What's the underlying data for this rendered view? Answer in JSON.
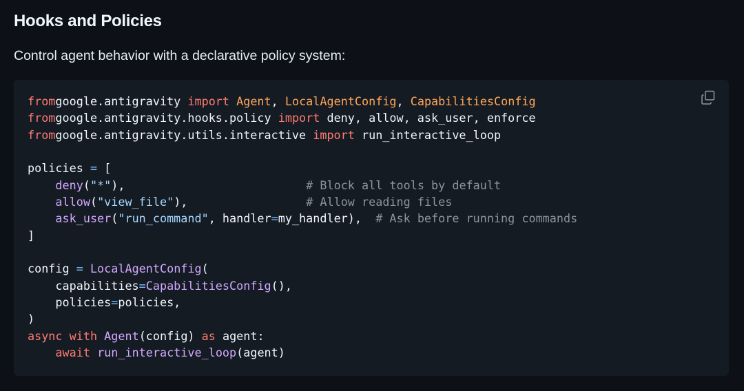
{
  "article": {
    "heading": "Hooks and Policies",
    "intro": "Control agent behavior with a declarative policy system:"
  },
  "code_block": {
    "copy_icon": "copy-icon",
    "language": "python",
    "lines": [
      [
        [
          "kw",
          "from"
        ],
        [
          "",
          "google.antigravity "
        ],
        [
          "kw",
          "import"
        ],
        [
          "",
          ""
        ],
        [
          "cls",
          "Agent"
        ],
        [
          "",
          ", "
        ],
        [
          "cls",
          "LocalAgentConfig"
        ],
        [
          "",
          ", "
        ],
        [
          "cls",
          "CapabilitiesConfig"
        ]
      ],
      [
        [
          "kw",
          "from"
        ],
        [
          "",
          "google.antigravity.hooks.policy "
        ],
        [
          "kw",
          "import"
        ],
        [
          "",
          ""
        ],
        [
          "",
          "deny, allow, ask_user, enforce"
        ]
      ],
      [
        [
          "kw",
          "from"
        ],
        [
          "",
          "google.antigravity.utils.interactive "
        ],
        [
          "kw",
          "import"
        ],
        [
          "",
          ""
        ],
        [
          "",
          "run_interactive_loop"
        ]
      ],
      [],
      [
        [
          "",
          "policies "
        ],
        [
          "op",
          "="
        ],
        [
          "",
          " ["
        ]
      ],
      [
        [
          "",
          "    "
        ],
        [
          "fn",
          "deny"
        ],
        [
          "",
          "("
        ],
        [
          "str",
          "\"*\""
        ],
        [
          "",
          "),"
        ],
        [
          "",
          "                          "
        ],
        [
          "cm",
          "# Block all tools by default"
        ]
      ],
      [
        [
          "",
          "    "
        ],
        [
          "fn",
          "allow"
        ],
        [
          "",
          "("
        ],
        [
          "str",
          "\"view_file\""
        ],
        [
          "",
          "),"
        ],
        [
          "",
          "                 "
        ],
        [
          "cm",
          "# Allow reading files"
        ]
      ],
      [
        [
          "",
          "    "
        ],
        [
          "fn",
          "ask_user"
        ],
        [
          "",
          "("
        ],
        [
          "str",
          "\"run_command\""
        ],
        [
          "",
          ", handler"
        ],
        [
          "op",
          "="
        ],
        [
          "",
          "my_handler),  "
        ],
        [
          "cm",
          "# Ask before running commands"
        ]
      ],
      [
        [
          "",
          "]"
        ]
      ],
      [],
      [
        [
          "",
          "config "
        ],
        [
          "op",
          "="
        ],
        [
          "",
          ""
        ],
        [
          "fn",
          "LocalAgentConfig"
        ],
        [
          "",
          "("
        ]
      ],
      [
        [
          "",
          "    capabilities"
        ],
        [
          "op",
          "="
        ],
        [
          "fn",
          "CapabilitiesConfig"
        ],
        [
          "",
          "(),"
        ]
      ],
      [
        [
          "",
          "    policies"
        ],
        [
          "op",
          "="
        ],
        [
          "",
          "policies,"
        ]
      ],
      [
        [
          "",
          ")"
        ]
      ],
      [
        [
          "kw",
          "async"
        ],
        [
          "",
          ""
        ],
        [
          "kw",
          "with"
        ],
        [
          "",
          ""
        ],
        [
          "fn",
          "Agent"
        ],
        [
          "",
          "(config) "
        ],
        [
          "kw",
          "as"
        ],
        [
          "",
          " agent:"
        ]
      ],
      [
        [
          "",
          "    "
        ],
        [
          "kw",
          "await"
        ],
        [
          "",
          ""
        ],
        [
          "fn",
          "run_interactive_loop"
        ],
        [
          "",
          "(agent)"
        ]
      ]
    ]
  }
}
